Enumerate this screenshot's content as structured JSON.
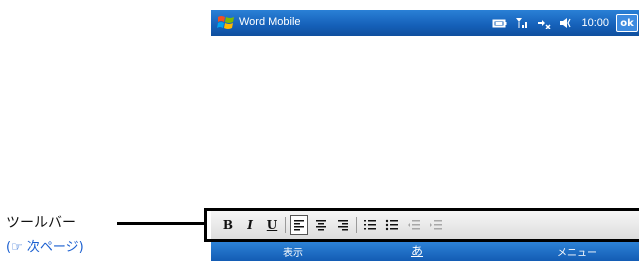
{
  "titlebar": {
    "app_title": "Word Mobile",
    "time": "10:00",
    "ok_label": "ok"
  },
  "toolbar": {
    "bold": "B",
    "italic": "I",
    "underline": "U",
    "align_left": "≡",
    "align_center": "≡",
    "align_right": "≡",
    "numbered_list": "⋮≡",
    "bulleted_list": "⁝≡",
    "decrease_indent": "⇤",
    "increase_indent": "⇥"
  },
  "softkeys": {
    "left": "表示",
    "center": "あ",
    "right": "メニュー"
  },
  "annotation": {
    "label": "ツールバー",
    "see_next": "(☞ 次ページ)"
  },
  "colors": {
    "titlebar": "#1560b8",
    "softkeys": "#1f6fc6",
    "toolbar": "#e6e6e6",
    "link": "#1a5fd0"
  }
}
